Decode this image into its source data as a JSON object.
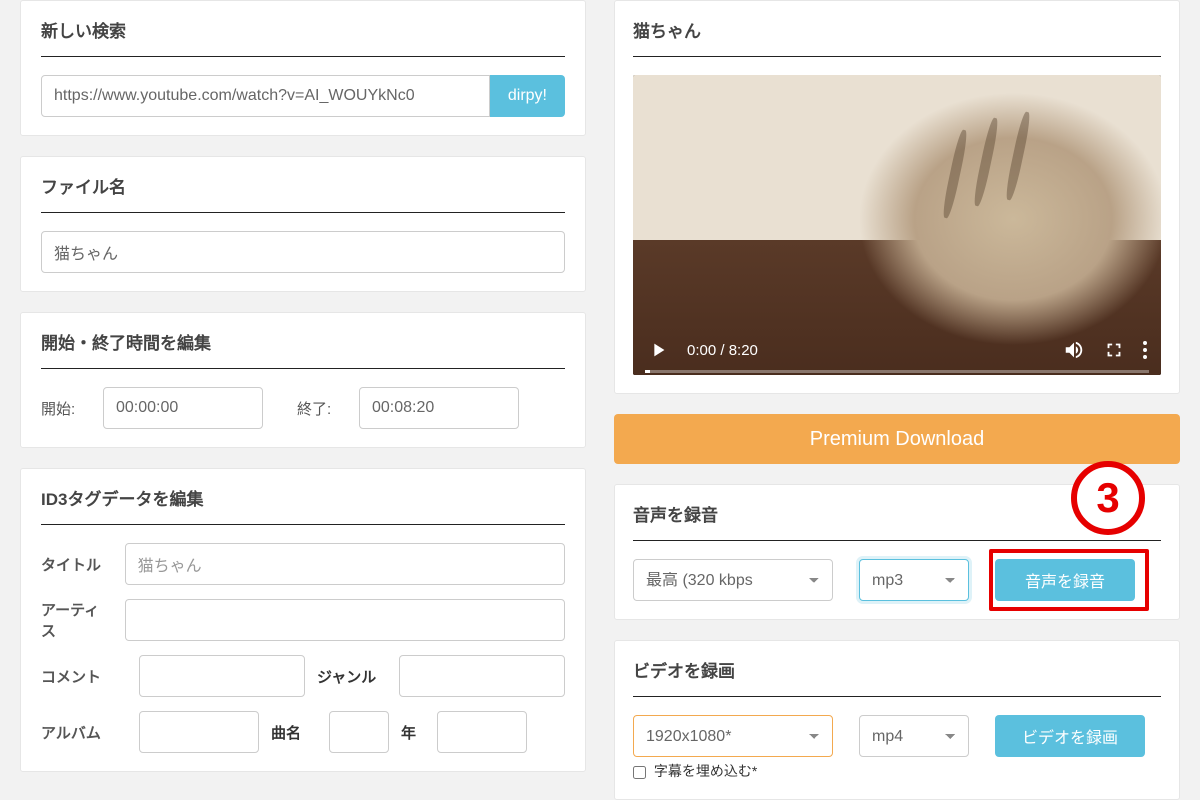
{
  "search": {
    "title": "新しい検索",
    "url_value": "https://www.youtube.com/watch?v=AI_WOUYkNc0",
    "button_label": "dirpy!"
  },
  "filename": {
    "title": "ファイル名",
    "value": "猫ちゃん"
  },
  "time_edit": {
    "title": "開始・終了時間を編集",
    "start_label": "開始:",
    "start_value": "00:00:00",
    "end_label": "終了:",
    "end_value": "00:08:20"
  },
  "id3": {
    "title": "ID3タグデータを編集",
    "title_label": "タイトル",
    "title_value": "猫ちゃん",
    "artist_label": "アーティス",
    "comment_label": "コメント",
    "genre_label": "ジャンル",
    "album_label": "アルバム",
    "track_label": "曲名",
    "year_label": "年"
  },
  "video_panel": {
    "title": "猫ちゃん",
    "time_display": "0:00 / 8:20"
  },
  "premium_button": "Premium Download",
  "audio": {
    "title": "音声を録音",
    "quality": "最高 (320 kbps",
    "format": "mp3",
    "button_label": "音声を録音"
  },
  "video": {
    "title": "ビデオを録画",
    "resolution": "1920x1080*",
    "format": "mp4",
    "button_label": "ビデオを録画",
    "subtitle_label": "字幕を埋め込む*"
  },
  "annotation_number": "3"
}
